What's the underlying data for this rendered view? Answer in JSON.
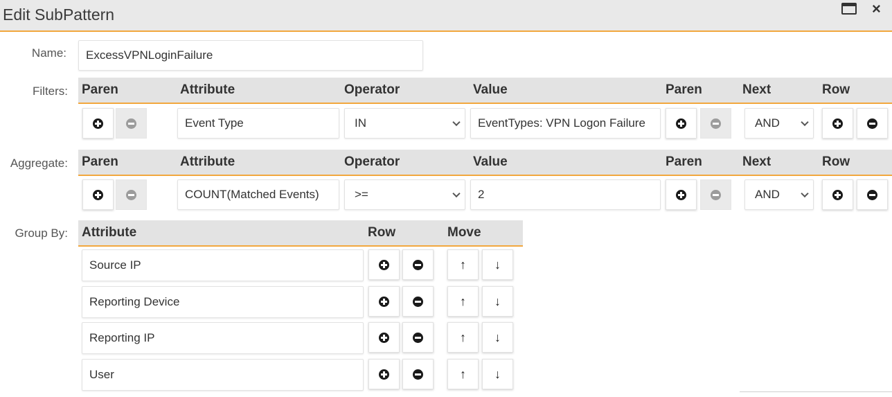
{
  "window": {
    "title": "Edit SubPattern",
    "maximize_icon": "maximize-icon",
    "close_glyph": "×"
  },
  "name": {
    "label": "Name:",
    "value": "ExcessVPNLoginFailure"
  },
  "filters": {
    "label": "Filters:",
    "headers": {
      "paren1": "Paren",
      "attribute": "Attribute",
      "operator": "Operator",
      "value": "Value",
      "paren2": "Paren",
      "next": "Next",
      "row": "Row"
    },
    "row": {
      "attribute": "Event Type",
      "operator": "IN",
      "value": "EventTypes: VPN Logon Failure",
      "next": "AND"
    }
  },
  "aggregate": {
    "label": "Aggregate:",
    "headers": {
      "paren1": "Paren",
      "attribute": "Attribute",
      "operator": "Operator",
      "value": "Value",
      "paren2": "Paren",
      "next": "Next",
      "row": "Row"
    },
    "row": {
      "attribute": "COUNT(Matched Events)",
      "operator": ">=",
      "value": "2",
      "next": "AND"
    }
  },
  "group_by": {
    "label": "Group By:",
    "headers": {
      "attribute": "Attribute",
      "row": "Row",
      "move": "Move"
    },
    "rows": [
      {
        "attribute": "Source IP"
      },
      {
        "attribute": "Reporting Device"
      },
      {
        "attribute": "Reporting IP"
      },
      {
        "attribute": "User"
      }
    ]
  },
  "icons": {
    "add": "plus-circle-icon",
    "remove": "minus-circle-icon",
    "up": "arrow-up-icon",
    "down": "arrow-down-icon"
  },
  "colors": {
    "accent": "#f2a73d",
    "header_bg": "#e3e3e3",
    "titlebar_bg": "#e9e9e9"
  }
}
